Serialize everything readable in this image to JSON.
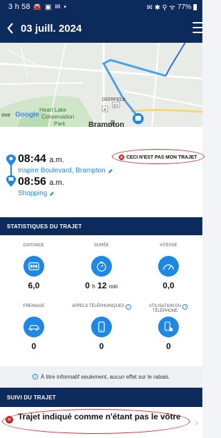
{
  "status_bar": {
    "time": "3 h 58",
    "left_icons": "🚘 ▣ ✉ •",
    "right_icons": "✉ ✱ ⚲ ᯤ ",
    "battery": "77%"
  },
  "header": {
    "title": "03 juill. 2024"
  },
  "map": {
    "labels": {
      "heart_lake_1": "Heart Lake",
      "heart_lake_2": "Conservation",
      "park": "Park",
      "ove": "ove",
      "google": "Google",
      "deerfield": "DEERFIELD",
      "brampton": "Brampton",
      "road_4": "4",
      "road_10": "10"
    }
  },
  "trip": {
    "start": {
      "time": "08:44",
      "ampm": "a.m.",
      "place": "Inspire Boulevard, Brampton"
    },
    "end": {
      "time": "08:56",
      "ampm": "a.m.",
      "place": "Shopping"
    },
    "not_mine_label": "CECI N'EST PAS MON TRAJET"
  },
  "stats_section": {
    "title": "STATISTIQUES DU TRAJET",
    "items": [
      {
        "label": "DISTANCE",
        "value": "6,0",
        "icon": "odometer-icon"
      },
      {
        "label": "DURÉE",
        "value_h": "0",
        "unit_h": "h",
        "value_m": "12",
        "unit_m": "min",
        "icon": "timer-icon"
      },
      {
        "label": "VITESSE",
        "value": "0,0",
        "icon": "speedometer-icon"
      },
      {
        "label": "FREINAGE",
        "value": "0",
        "icon": "braking-icon"
      },
      {
        "label": "APPELS TÉLÉPHONIQUES",
        "value": "0",
        "icon": "phone-icon"
      },
      {
        "label_1": "UTILISATION DU",
        "label_2": "TÉLÉPHONE",
        "value": "0",
        "icon": "phone-touch-icon"
      }
    ],
    "note": "À titre informatif seulement, aucun effet sur le rabais."
  },
  "follow_section": {
    "title": "SUIVI DU TRAJET",
    "status": "Trajet indiqué comme n'étant pas le vôtre"
  },
  "colors": {
    "navy": "#0d2a5c",
    "accent": "#1e88e5",
    "alert": "#c62828"
  }
}
